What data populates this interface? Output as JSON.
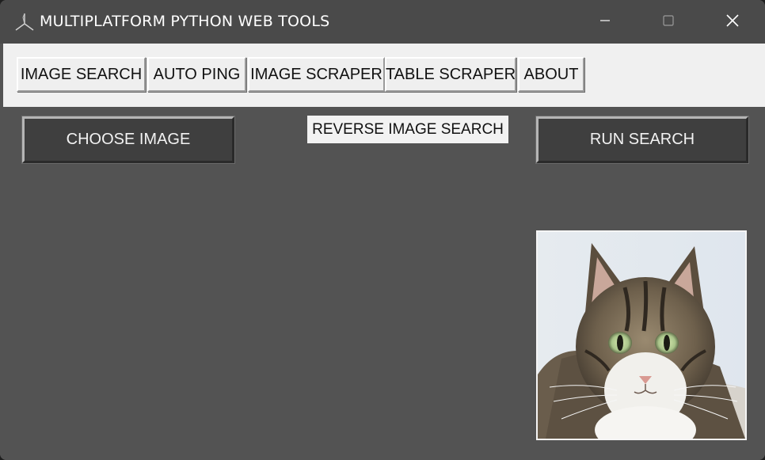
{
  "window": {
    "title": "MULTIPLATFORM PYTHON WEB TOOLS",
    "app_icon": "tk-feather-icon",
    "controls": {
      "minimize_icon": "minimize-icon",
      "maximize_icon": "maximize-icon",
      "close_icon": "close-icon"
    }
  },
  "tabs": [
    {
      "label": "IMAGE SEARCH"
    },
    {
      "label": "AUTO PING"
    },
    {
      "label": "IMAGE SCRAPER"
    },
    {
      "label": "TABLE SCRAPER"
    },
    {
      "label": "ABOUT"
    }
  ],
  "main": {
    "choose_button": "CHOOSE IMAGE",
    "heading": "REVERSE IMAGE SEARCH",
    "run_button": "RUN SEARCH",
    "preview_image": "cat-photo"
  },
  "colors": {
    "titlebar": "#4a4a4a",
    "background": "#535353",
    "tabstrip": "#f0f0f0",
    "button_dark": "#3f3f3f"
  }
}
